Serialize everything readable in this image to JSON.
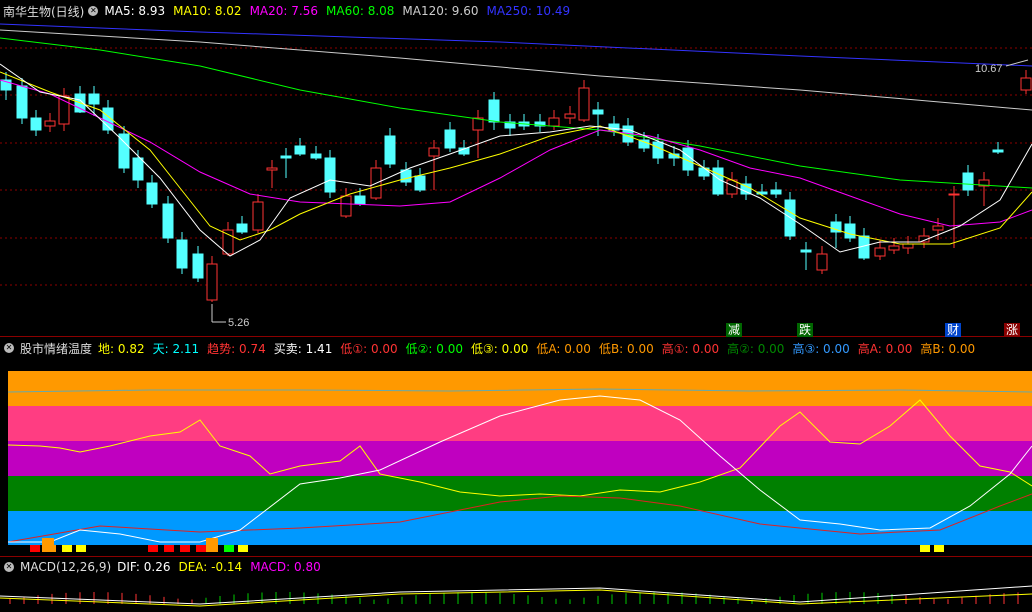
{
  "main": {
    "stock_name": "南华生物(日线)",
    "ma": [
      {
        "label": "MA5: 8.93",
        "color": "#ffffff"
      },
      {
        "label": "MA10: 8.02",
        "color": "#ffff00"
      },
      {
        "label": "MA20: 7.56",
        "color": "#ff00ff"
      },
      {
        "label": "MA60: 8.08",
        "color": "#00ff00"
      },
      {
        "label": "MA120: 9.60",
        "color": "#cccccc"
      },
      {
        "label": "MA250: 10.49",
        "color": "#3333ff"
      }
    ],
    "high_price": "10.67",
    "low_price": "5.26",
    "signals": [
      {
        "text": "减",
        "color": "#ffffff",
        "bg": "#006600"
      },
      {
        "text": "跌",
        "color": "#ffffff",
        "bg": "#006600"
      },
      {
        "text": "财",
        "color": "#ffffff",
        "bg": "#0044cc"
      },
      {
        "text": "涨",
        "color": "#ffffff",
        "bg": "#880000"
      }
    ]
  },
  "indicator": {
    "name": "股市情绪温度",
    "items": [
      {
        "label": "地: 0.82",
        "color": "#ffff00"
      },
      {
        "label": "天: 2.11",
        "color": "#00ffff"
      },
      {
        "label": "趋势: 0.74",
        "color": "#ff3333"
      },
      {
        "label": "买卖: 1.41",
        "color": "#ffffff"
      },
      {
        "label": "低①: 0.00",
        "color": "#ff3333"
      },
      {
        "label": "低②: 0.00",
        "color": "#00ff00"
      },
      {
        "label": "低③: 0.00",
        "color": "#ffff00"
      },
      {
        "label": "低A: 0.00",
        "color": "#ff9900"
      },
      {
        "label": "低B: 0.00",
        "color": "#ff9900"
      },
      {
        "label": "高①: 0.00",
        "color": "#ff3333"
      },
      {
        "label": "高②: 0.00",
        "color": "#008800"
      },
      {
        "label": "高③: 0.00",
        "color": "#3399ff"
      },
      {
        "label": "高A: 0.00",
        "color": "#ff3333"
      },
      {
        "label": "高B: 0.00",
        "color": "#ff9900"
      }
    ]
  },
  "macd": {
    "name": "MACD(12,26,9)",
    "items": [
      {
        "label": "DIF: 0.26",
        "color": "#ffffff"
      },
      {
        "label": "DEA: -0.14",
        "color": "#ffff00"
      },
      {
        "label": "MACD: 0.80",
        "color": "#ff00ff"
      }
    ]
  },
  "colors": {
    "up": "#ff3333",
    "down": "#54ffff",
    "grid": "#8b0000"
  }
}
